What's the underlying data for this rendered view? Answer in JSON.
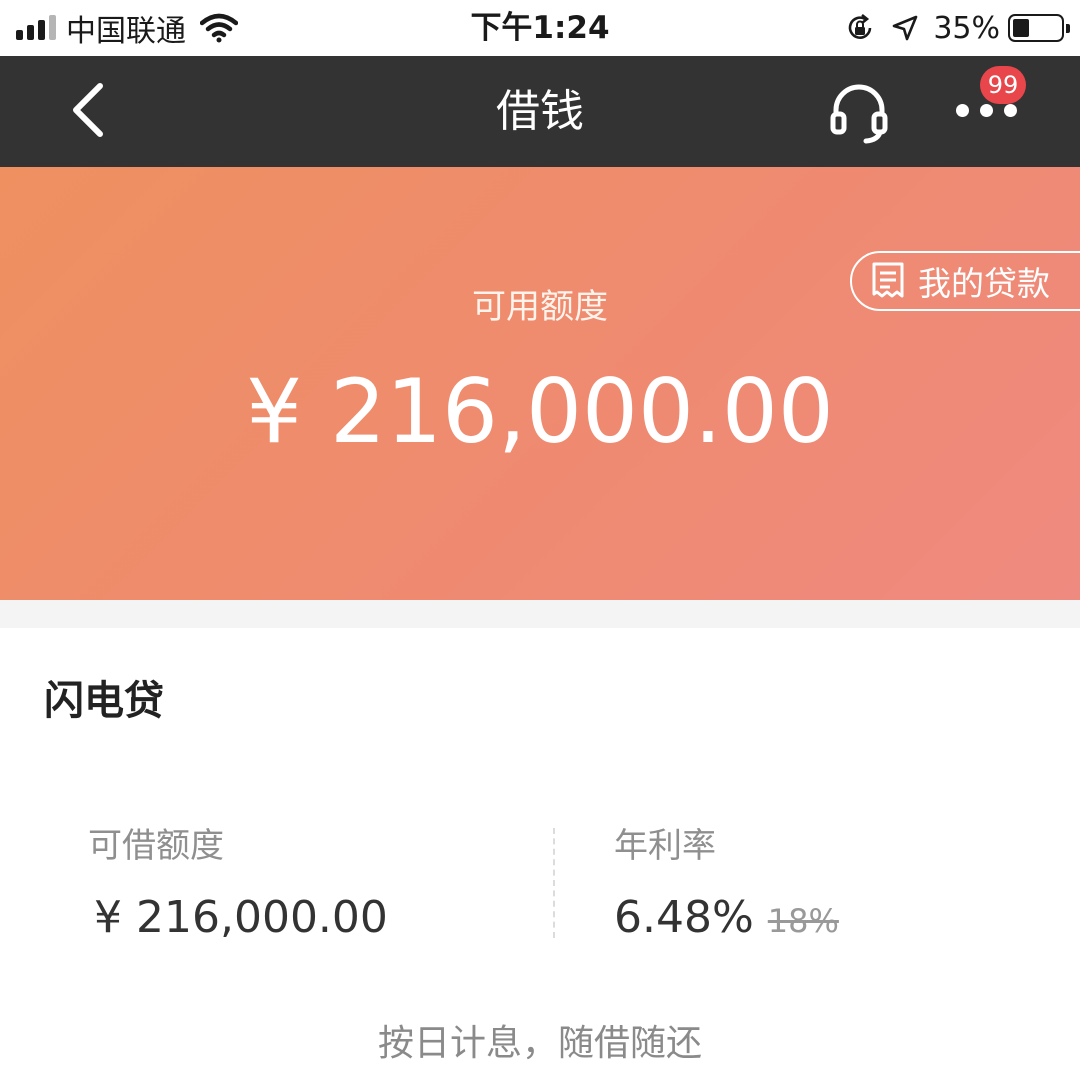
{
  "status_bar": {
    "carrier": "中国联通",
    "time": "下午1:24",
    "battery_percent": "35%",
    "icons": [
      "signal-icon",
      "wifi-icon",
      "rotation-lock-icon",
      "location-arrow-icon",
      "battery-icon"
    ]
  },
  "nav": {
    "title": "借钱",
    "back_icon": "chevron-left-icon",
    "support_icon": "headset-icon",
    "more_icon": "more-dots-icon",
    "badge_count": "99"
  },
  "hero": {
    "my_loans_label": "我的贷款",
    "my_loans_icon": "receipt-icon",
    "label": "可用额度",
    "amount": "¥ 216,000.00"
  },
  "product": {
    "title": "闪电贷",
    "limit_label": "可借额度",
    "limit_value": "¥ 216,000.00",
    "rate_label": "年利率",
    "rate_value": "6.48%",
    "rate_original": "18%",
    "note": "按日计息，随借随还"
  },
  "colors": {
    "nav_background": "#333333",
    "hero_gradient_start": "#ee9060",
    "hero_gradient_end": "#ef8a80",
    "badge": "#e8464b"
  }
}
